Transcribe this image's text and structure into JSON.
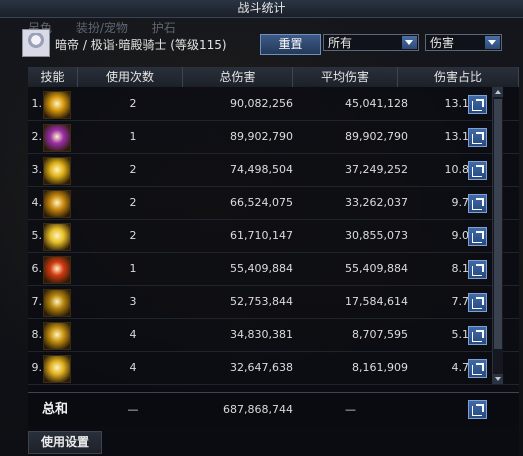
{
  "window": {
    "title": "战斗统计"
  },
  "ghost_tabs": [
    "另色",
    "装扮/宠物",
    "护石"
  ],
  "header": {
    "character": "暗帝 / 极诣·暗殿骑士 (等级115)",
    "reset_label": "重置",
    "scope_select": "所有",
    "type_select": "伤害"
  },
  "columns": [
    "技能",
    "使用次数",
    "总伤害",
    "平均伤害",
    "伤害占比"
  ],
  "rows": [
    {
      "idx": "1.",
      "count": "2",
      "total": "90,082,256",
      "avg": "45,041,128",
      "pct": "13.1 %",
      "icon_color": "#d79a10"
    },
    {
      "idx": "2.",
      "count": "1",
      "total": "89,902,790",
      "avg": "89,902,790",
      "pct": "13.1 %",
      "icon_color": "#9b2fa8"
    },
    {
      "idx": "3.",
      "count": "2",
      "total": "74,498,504",
      "avg": "37,249,252",
      "pct": "10.8 %",
      "icon_color": "#e0b318"
    },
    {
      "idx": "4.",
      "count": "2",
      "total": "66,524,075",
      "avg": "33,262,037",
      "pct": "9.7 %",
      "icon_color": "#c98a10"
    },
    {
      "idx": "5.",
      "count": "2",
      "total": "61,710,147",
      "avg": "30,855,073",
      "pct": "9.0 %",
      "icon_color": "#e8c02a"
    },
    {
      "idx": "6.",
      "count": "1",
      "total": "55,409,884",
      "avg": "55,409,884",
      "pct": "8.1 %",
      "icon_color": "#d23a12"
    },
    {
      "idx": "7.",
      "count": "3",
      "total": "52,753,844",
      "avg": "17,584,614",
      "pct": "7.7 %",
      "icon_color": "#b6850f"
    },
    {
      "idx": "8.",
      "count": "4",
      "total": "34,830,381",
      "avg": "8,707,595",
      "pct": "5.1 %",
      "icon_color": "#c99513"
    },
    {
      "idx": "9.",
      "count": "4",
      "total": "32,647,638",
      "avg": "8,161,909",
      "pct": "4.7 %",
      "icon_color": "#e0b01f"
    }
  ],
  "summary": {
    "label": "总和",
    "count": "—",
    "total": "687,868,744",
    "avg": "—"
  },
  "settings_label": "使用设置"
}
